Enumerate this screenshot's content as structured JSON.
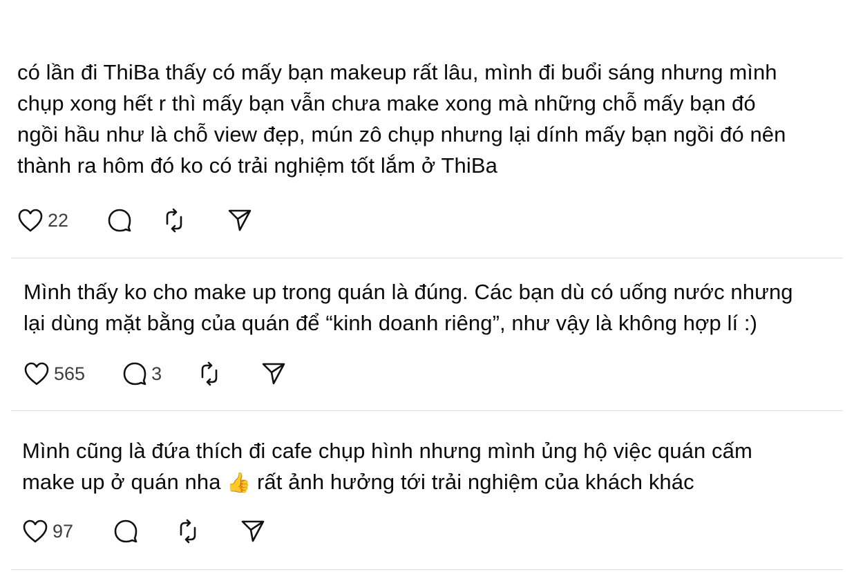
{
  "posts": [
    {
      "lines": [
        "có lần đi ThiBa thấy có mấy bạn makeup rất lâu, mình đi buổi sáng nhưng mình",
        "chụp xong hết r thì mấy bạn vẫn chưa make xong mà những chỗ mấy bạn đó",
        "ngồi hầu như là chỗ view đẹp, mún zô chụp nhưng lại dính mấy bạn ngồi đó nên",
        "thành ra hôm đó ko có trải nghiệm tốt lắm ở ThiBa"
      ],
      "likes": "22",
      "replies": ""
    },
    {
      "lines": [
        "Mình thấy ko cho make up trong quán là đúng. Các bạn dù có uống nước nhưng",
        "lại dùng mặt bằng của quán để “kinh doanh riêng”, như vậy là không hợp lí :)"
      ],
      "likes": "565",
      "replies": "3"
    },
    {
      "lines": [
        "Mình cũng là đứa thích đi cafe chụp hình nhưng mình ủng hộ việc quán cấm",
        "make up ở quán nha",
        " rất ảnh hưởng tới trải nghiệm của khách khác"
      ],
      "emoji": "👍",
      "likes": "97",
      "replies": ""
    }
  ],
  "icons": {
    "like": "heart-icon",
    "reply": "comment-icon",
    "repost": "repost-icon",
    "share": "send-icon"
  }
}
